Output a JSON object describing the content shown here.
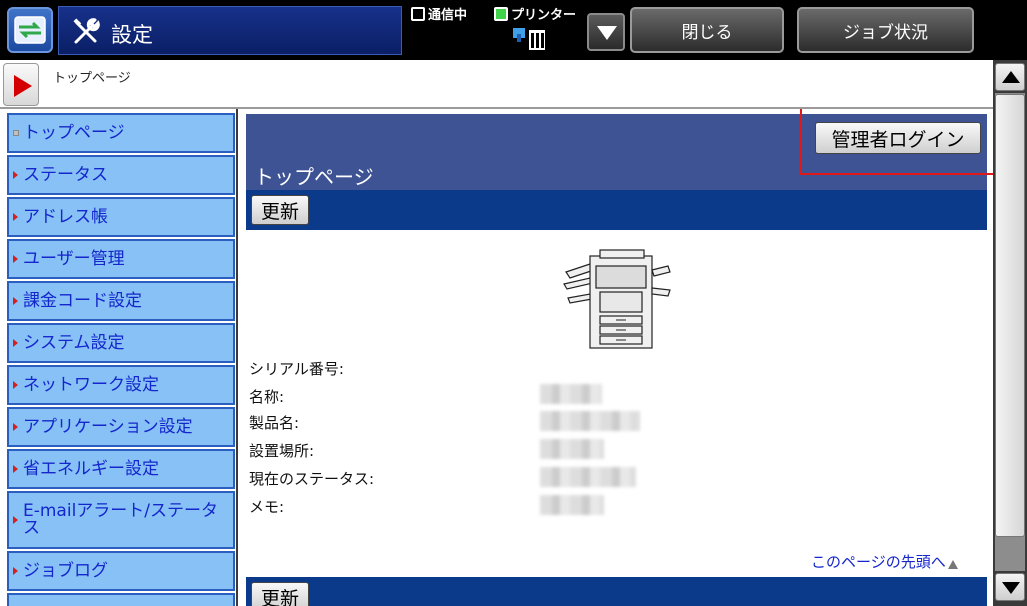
{
  "header": {
    "title": "設定",
    "comm_status": "通信中",
    "printer_status": "プリンター",
    "close_label": "閉じる",
    "job_status_label": "ジョブ状況"
  },
  "breadcrumb": {
    "text": "トップページ"
  },
  "sidebar": {
    "items": [
      {
        "label": "トップページ"
      },
      {
        "label": "ステータス"
      },
      {
        "label": "アドレス帳"
      },
      {
        "label": "ユーザー管理"
      },
      {
        "label": "課金コード設定"
      },
      {
        "label": "システム設定"
      },
      {
        "label": "ネットワーク設定"
      },
      {
        "label": "アプリケーション設定"
      },
      {
        "label": "省エネルギー設定"
      },
      {
        "label": "E-mailアラート/ステータス"
      },
      {
        "label": "ジョブログ"
      }
    ]
  },
  "main": {
    "page_title": "トップページ",
    "admin_login_label": "管理者ログイン",
    "refresh_label": "更新",
    "info_labels": [
      "シリアル番号:",
      "名称:",
      "製品名:",
      "設置場所:",
      "現在のステータス:",
      "メモ:"
    ],
    "top_link": "このページの先頭へ"
  },
  "colors": {
    "accent": "#0c3a8a",
    "sidebar_bg": "#87c1f5",
    "highlight": "#e01818"
  }
}
